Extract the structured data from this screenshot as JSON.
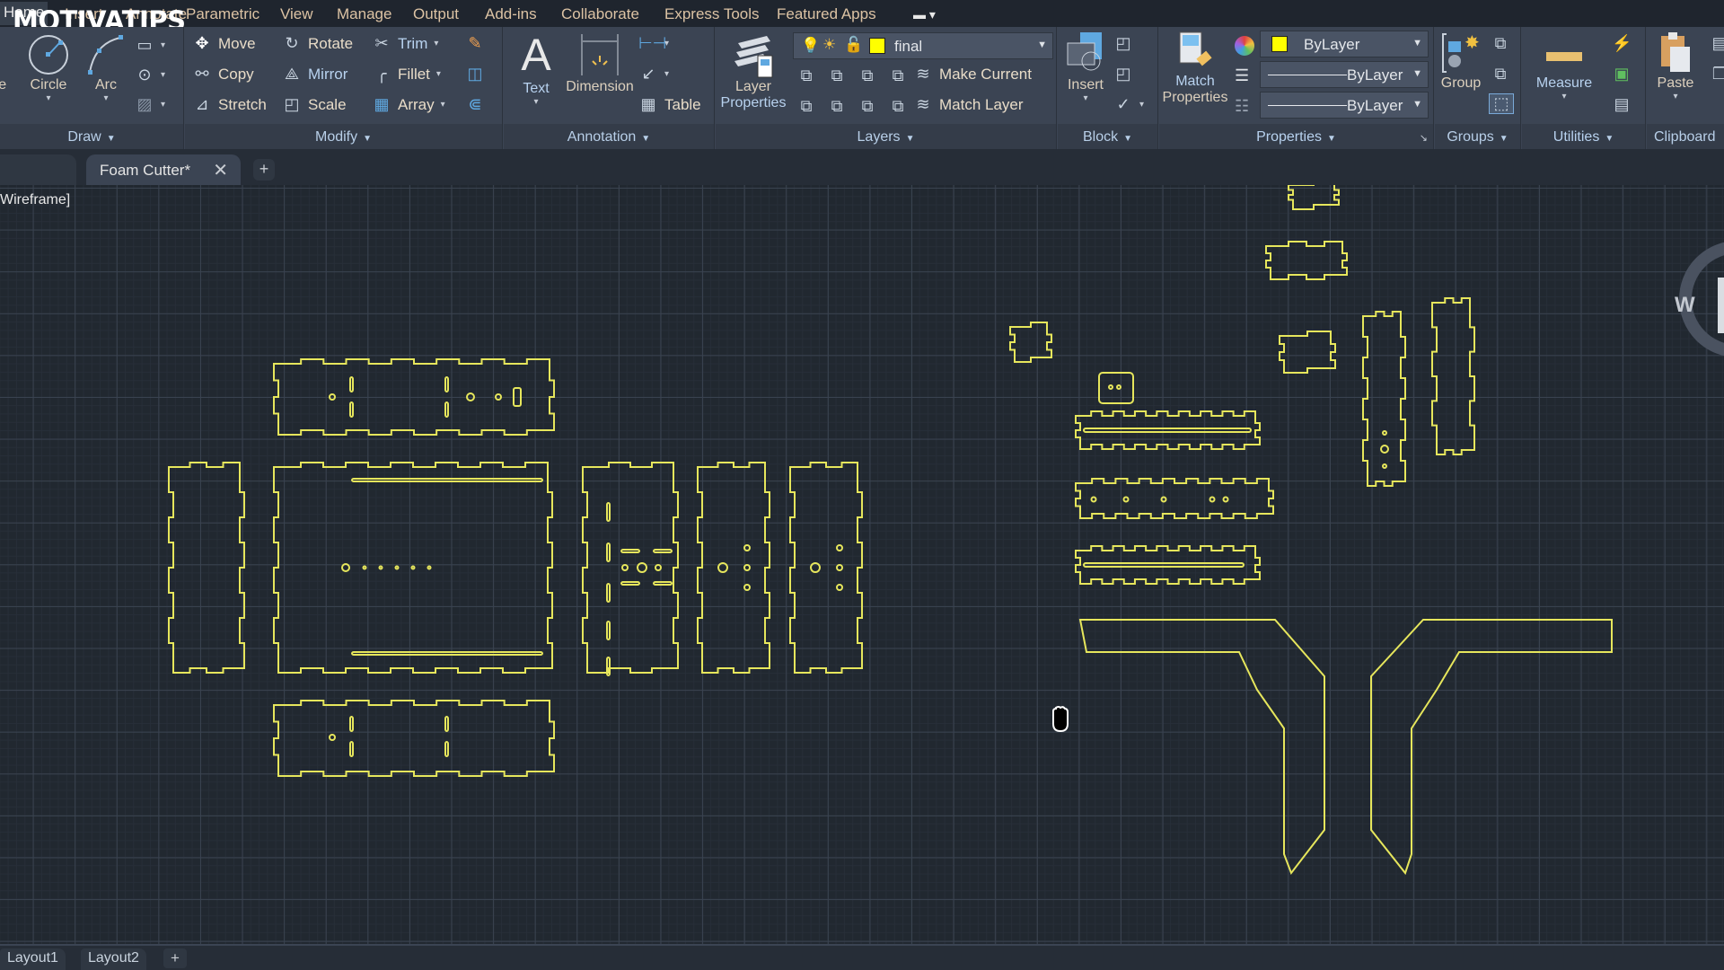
{
  "menubar": {
    "tabs": [
      "Home",
      "Insert",
      "Annotate",
      "Parametric",
      "View",
      "Manage",
      "Output",
      "Add-ins",
      "Collaborate",
      "Express Tools",
      "Featured Apps"
    ],
    "watermark": "MOTIVATIPS",
    "cloud_control_icon": "cloud-toggle-icon"
  },
  "ribbon": {
    "draw": {
      "title": "Draw",
      "line_label": "Line",
      "circle_label": "Circle",
      "arc_label": "Arc"
    },
    "modify": {
      "title": "Modify",
      "move": "Move",
      "rotate": "Rotate",
      "trim": "Trim",
      "copy": "Copy",
      "mirror": "Mirror",
      "fillet": "Fillet",
      "stretch": "Stretch",
      "scale": "Scale",
      "array": "Array"
    },
    "annotation": {
      "title": "Annotation",
      "text": "Text",
      "dimension": "Dimension",
      "table": "Table"
    },
    "layers": {
      "title": "Layers",
      "layer_properties_line1": "Layer",
      "layer_properties_line2": "Properties",
      "current_layer": "final",
      "current_layer_color": "#ffff00",
      "make_current": "Make Current",
      "match_layer": "Match Layer"
    },
    "block": {
      "title": "Block",
      "insert": "Insert"
    },
    "properties": {
      "title": "Properties",
      "match_line1": "Match",
      "match_line2": "Properties",
      "color_value": "ByLayer",
      "color_swatch": "#ffff00",
      "lineweight_value": "ByLayer",
      "linetype_value": "ByLayer"
    },
    "groups": {
      "title": "Groups",
      "group": "Group"
    },
    "utilities": {
      "title": "Utilities",
      "measure": "Measure"
    },
    "clipboard": {
      "title": "Clipboard",
      "paste": "Paste"
    }
  },
  "filetabs": {
    "document": "Foam Cutter*",
    "close_icon": "close-icon",
    "new_tab": "+"
  },
  "viewport": {
    "view_label": "Wireframe]",
    "viewcube_label": "W",
    "line_color": "#e6e65c"
  },
  "layout_tabs": [
    "Layout1",
    "Layout2"
  ],
  "layout_add": "+"
}
